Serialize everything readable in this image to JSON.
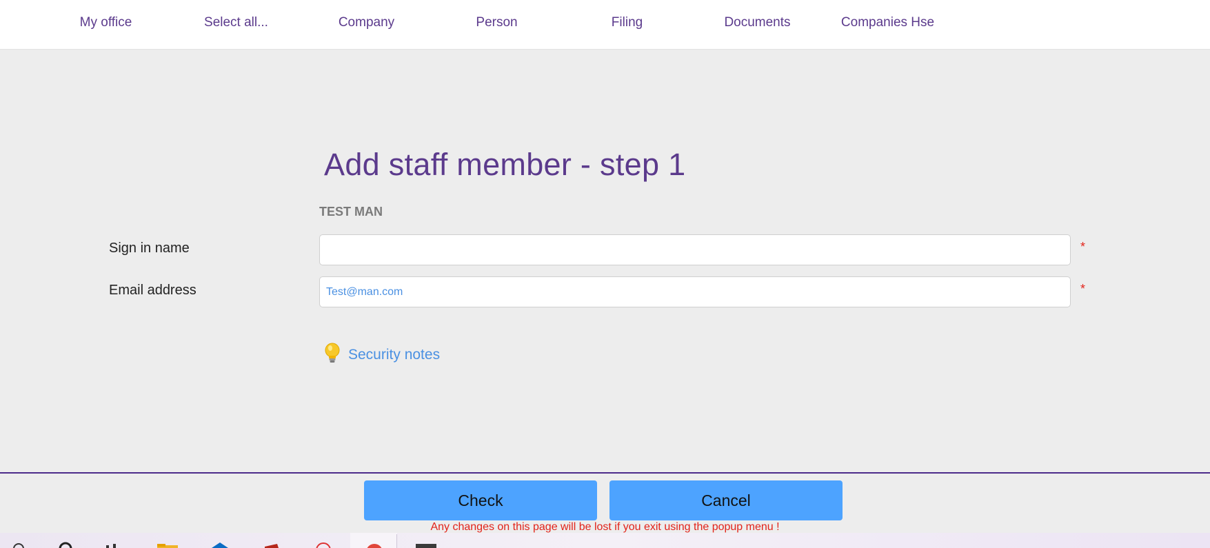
{
  "nav": {
    "items": [
      {
        "label": "My office"
      },
      {
        "label": "Select all..."
      },
      {
        "label": "Company"
      },
      {
        "label": "Person"
      },
      {
        "label": "Filing"
      },
      {
        "label": "Documents"
      },
      {
        "label": "Companies Hse"
      }
    ]
  },
  "form": {
    "title": "Add staff member - step 1",
    "subtitle": "TEST MAN",
    "fields": {
      "sign_in_name": {
        "label": "Sign in name",
        "value": ""
      },
      "email": {
        "label": "Email address",
        "value": "Test@man.com"
      }
    },
    "required_marker": "*",
    "security_notes": {
      "label": "Security notes",
      "icon": "lightbulb-icon"
    }
  },
  "footer": {
    "check_label": "Check",
    "cancel_label": "Cancel",
    "warning": "Any changes on this page will be lost if you exit using the popup menu !"
  },
  "colors": {
    "brand_purple": "#5b3a8c",
    "link_blue": "#4a90e2",
    "button_blue": "#4da3ff",
    "required_red": "#e2231a"
  }
}
